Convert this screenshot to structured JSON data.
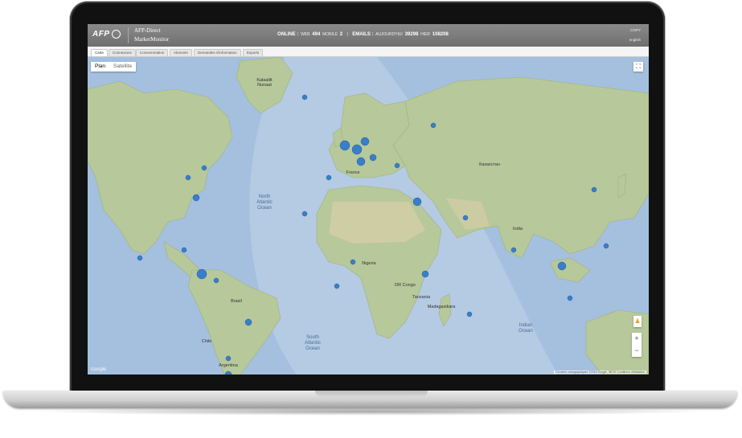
{
  "header": {
    "logo": "AFP",
    "title_line1": "AFP-Direct",
    "title_line2": "MarketMonitor",
    "online_label": "ONLINE :",
    "web_label": "WEB",
    "web_count": "494",
    "mobile_label": "MOBILE",
    "mobile_count": "2",
    "separator": "|",
    "emails_label": "EMAILS :",
    "today_label": "AUJOURD'HUI",
    "today_count": "39298",
    "yesterday_label": "HIER",
    "yesterday_count": "108208",
    "copy": "COPY",
    "language": "english"
  },
  "tabs": [
    {
      "label": "Carte"
    },
    {
      "label": "Connexions"
    },
    {
      "label": "Consommation"
    },
    {
      "label": "Abonnés"
    },
    {
      "label": "Demandes d'information"
    },
    {
      "label": "Exports"
    }
  ],
  "map": {
    "type_plan": "Plan",
    "type_satellite": "Satellite",
    "fullscreen_icon": "fullscreen-icon",
    "zoom_in": "+",
    "zoom_out": "−",
    "google_logo": "Google",
    "attribution": "Données cartographiques ©2015 Google, INEGI   Conditions d'utilisation",
    "labels": {
      "north_atlantic": "North\nAtlantic\nOcean",
      "south_atlantic": "South\nAtlantic\nOcean",
      "indian_ocean": "Indian\nOcean",
      "india": "India",
      "brazil": "Brasil",
      "kazakhstan": "Казахстан",
      "france": "France",
      "chile": "Chile",
      "argentina": "Argentina",
      "greenland": "Kalaallit\nNunaat",
      "dr_congo": "DR Congo",
      "madagascar": "Madagasikara",
      "nigeria": "Nigeria",
      "tanzania": "Tanzania"
    },
    "colors": {
      "ocean": "#a4c0de",
      "land": "#b7c89a",
      "marker": "#3a7ec8"
    }
  }
}
